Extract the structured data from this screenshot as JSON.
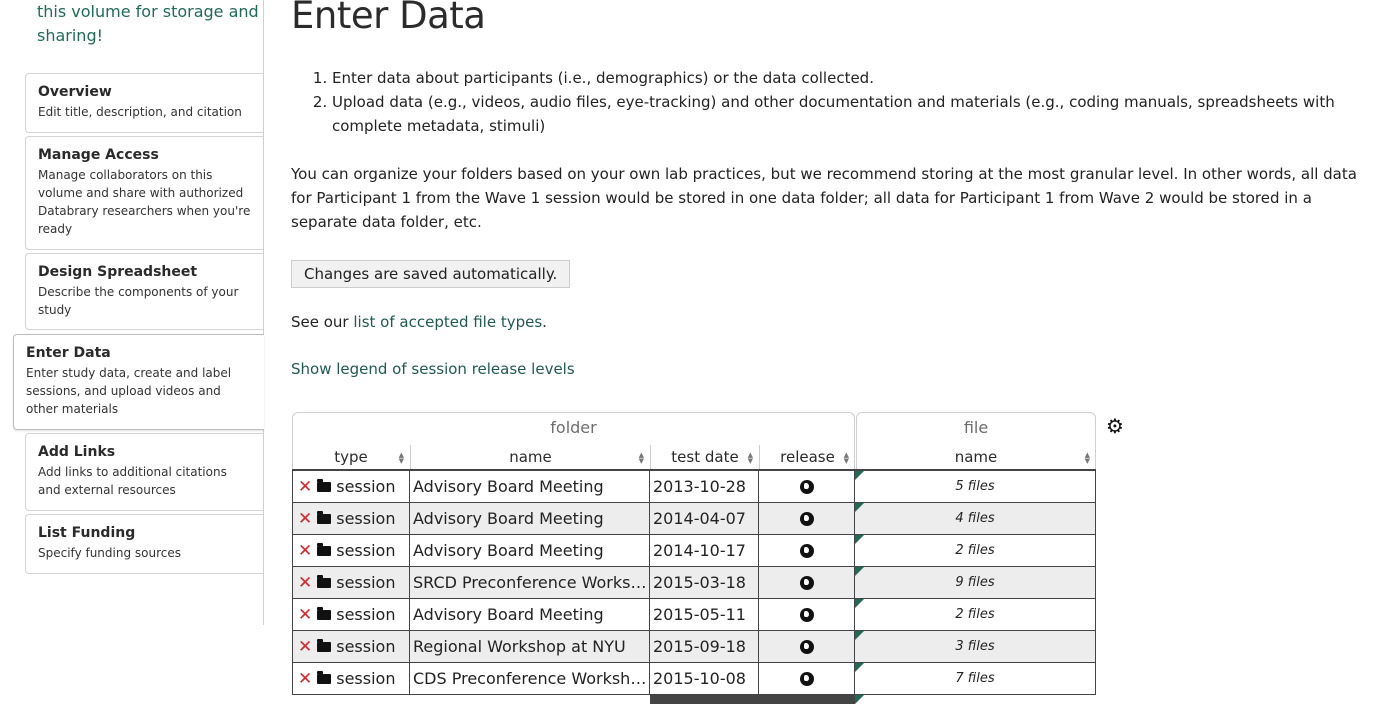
{
  "sidebar": {
    "intro": "this volume for storage and sharing!",
    "items": [
      {
        "title": "Overview",
        "desc": "Edit title, description, and citation"
      },
      {
        "title": "Manage Access",
        "desc": "Manage collaborators on this volume and share with authorized Databrary researchers when you're ready"
      },
      {
        "title": "Design Spreadsheet",
        "desc": "Describe the components of your study"
      },
      {
        "title": "Enter Data",
        "desc": "Enter study data, create and label sessions, and upload videos and other materials"
      },
      {
        "title": "Add Links",
        "desc": "Add links to additional citations and external resources"
      },
      {
        "title": "List Funding",
        "desc": "Specify funding sources"
      }
    ]
  },
  "main": {
    "title": "Enter Data",
    "steps": [
      "Enter data about participants (i.e., demographics) or the data collected.",
      "Upload data (e.g., videos, audio files, eye-tracking) and other documentation and materials (e.g., coding manuals, spreadsheets with complete metadata, stimuli)"
    ],
    "paragraph": "You can organize your folders based on your own lab practices, but we recommend storing at the most granular level. In other words, all data for Participant 1 from the Wave 1 session would be stored in one data folder; all data for Participant 1 from Wave 2 would be stored in a separate data folder, etc.",
    "autosave_notice": "Changes are saved automatically.",
    "see_our_prefix": "See our ",
    "file_types_link": "list of accepted file types",
    "see_our_suffix": ".",
    "legend_link": "Show legend of session release levels"
  },
  "table": {
    "groups": {
      "folder": "folder",
      "file": "file"
    },
    "columns": {
      "type": "type",
      "name": "name",
      "test_date": "test date",
      "release": "release",
      "file_name": "name"
    },
    "sort_icon": "sort-arrows-icon",
    "settings_icon": "gear-icon",
    "rows": [
      {
        "type": "session",
        "name": "Advisory Board Meeting",
        "test_date": "2013-10-28",
        "release": "globe-icon",
        "files": "5 files"
      },
      {
        "type": "session",
        "name": "Advisory Board Meeting",
        "test_date": "2014-04-07",
        "release": "globe-icon",
        "files": "4 files"
      },
      {
        "type": "session",
        "name": "Advisory Board Meeting",
        "test_date": "2014-10-17",
        "release": "globe-icon",
        "files": "2 files"
      },
      {
        "type": "session",
        "name": "SRCD Preconference Workshop",
        "test_date": "2015-03-18",
        "release": "globe-icon",
        "files": "9 files"
      },
      {
        "type": "session",
        "name": "Advisory Board Meeting",
        "test_date": "2015-05-11",
        "release": "globe-icon",
        "files": "2 files"
      },
      {
        "type": "session",
        "name": "Regional Workshop at NYU",
        "test_date": "2015-09-18",
        "release": "globe-icon",
        "files": "3 files"
      },
      {
        "type": "session",
        "name": "CDS Preconference Workshop",
        "test_date": "2015-10-08",
        "release": "globe-icon",
        "files": "7 files"
      }
    ]
  },
  "colors": {
    "link": "#1e5a52",
    "delete": "#d3262b",
    "intro": "#1e6b58",
    "corner_flag": "#1f6b58"
  }
}
